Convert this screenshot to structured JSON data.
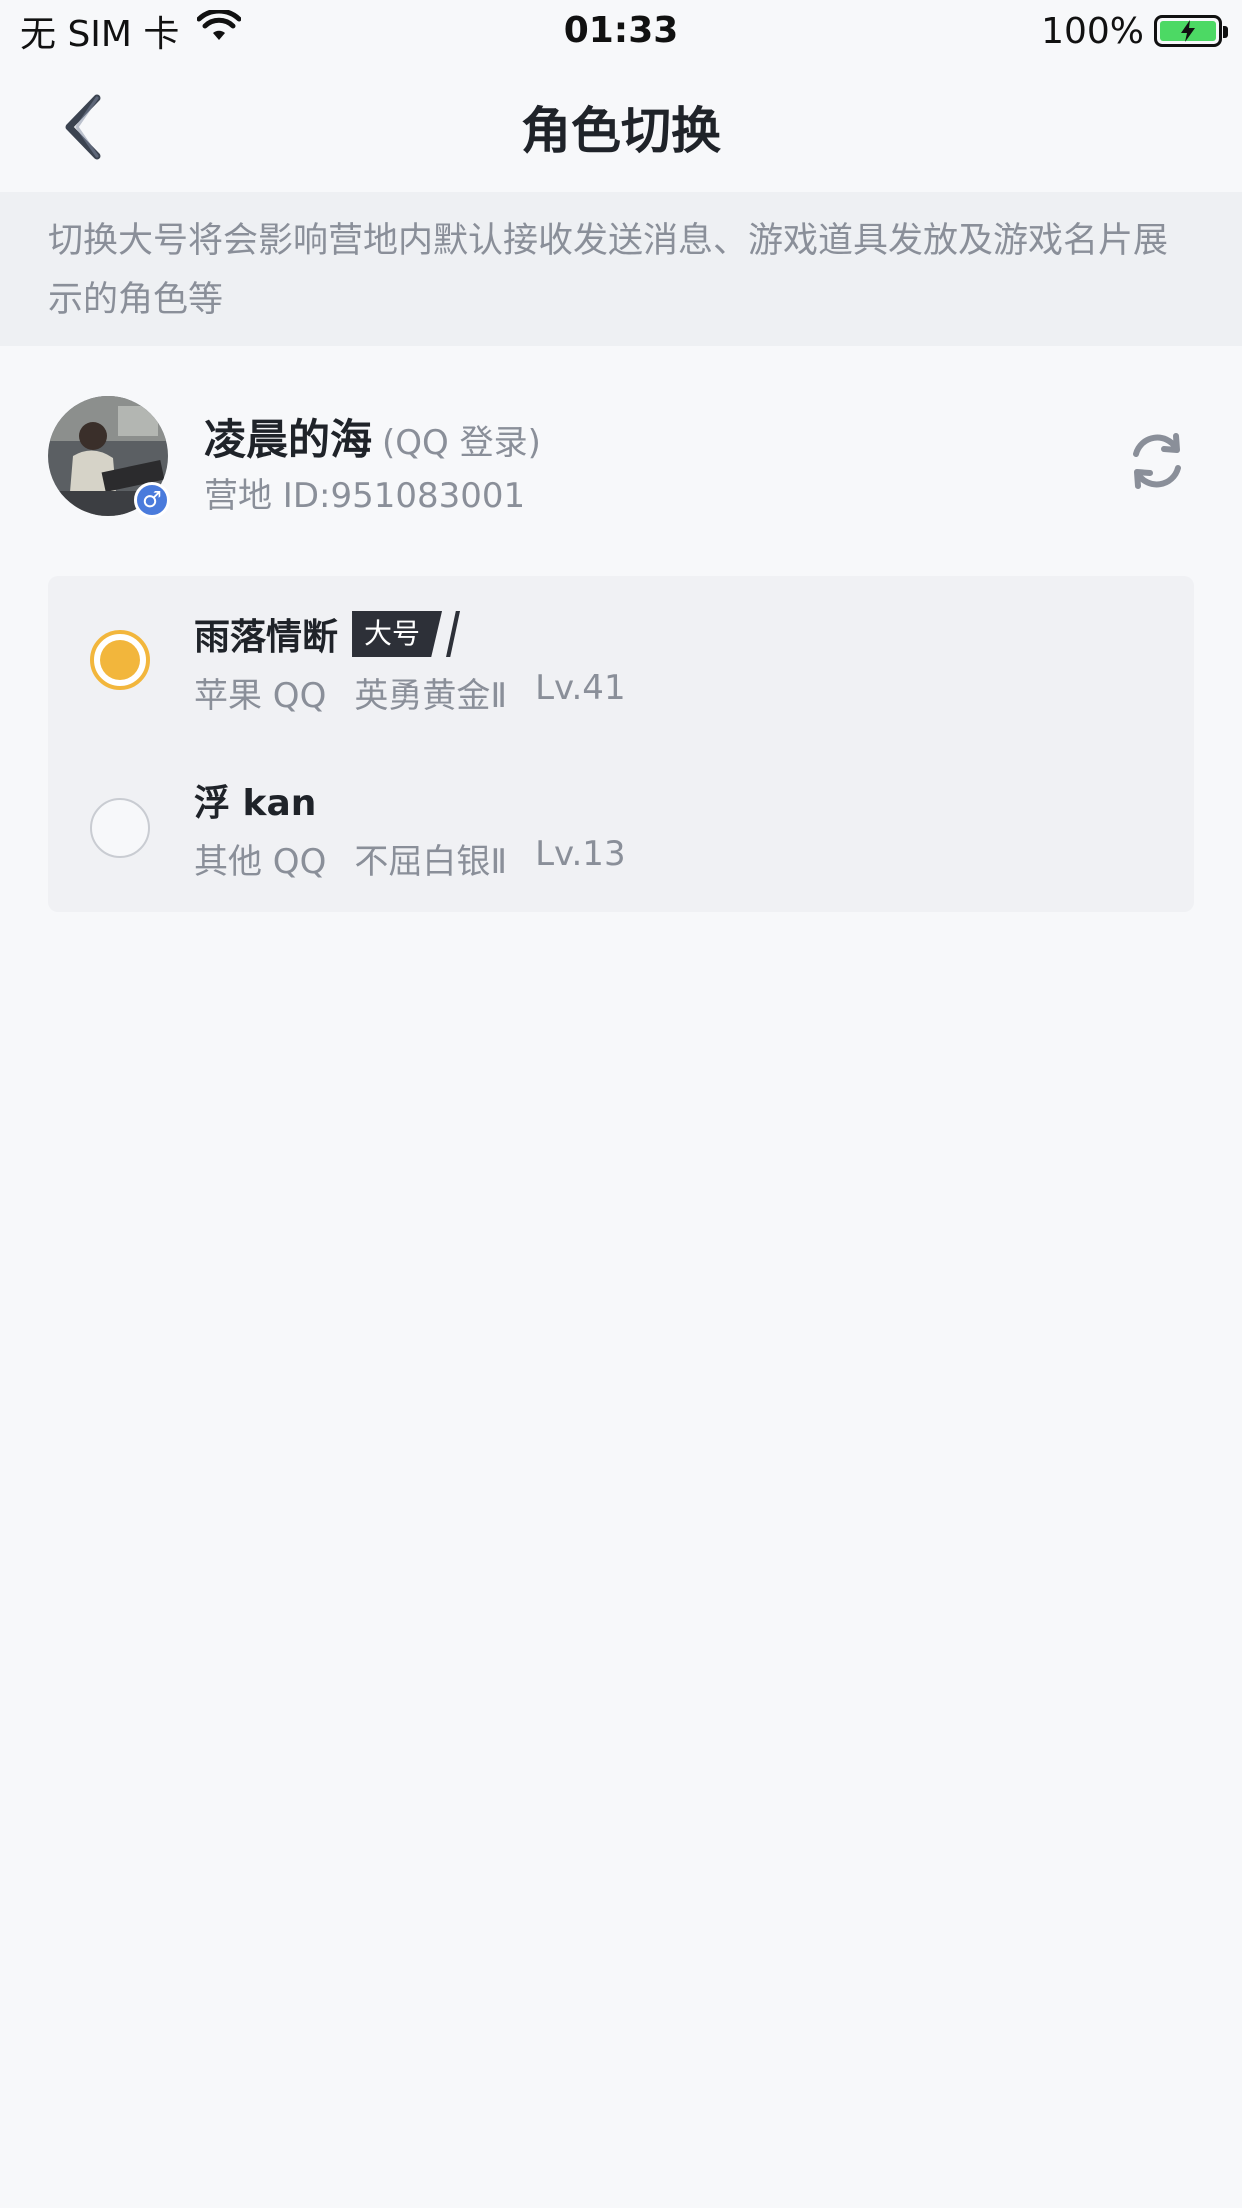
{
  "status_bar": {
    "carrier": "无 SIM 卡",
    "time": "01:33",
    "battery": "100%"
  },
  "nav": {
    "title": "角色切换",
    "back_icon": "chevron-left-icon"
  },
  "notice": {
    "text": "切换大号将会影响营地内默认接收发送消息、游戏道具发放及游戏名片展示的角色等"
  },
  "profile": {
    "name": "凌晨的海",
    "login_type": "(QQ 登录)",
    "id_label": "营地 ID:951083001",
    "gender_icon": "male-icon",
    "refresh_icon": "refresh-icon"
  },
  "roles": [
    {
      "name": "雨落情断",
      "badge": "大号",
      "platform": "苹果 QQ",
      "rank": "英勇黄金Ⅱ",
      "level": "Lv.41",
      "selected": true
    },
    {
      "name": "浮 kan",
      "badge": "",
      "platform": "其他 QQ",
      "rank": "不屈白银Ⅱ",
      "level": "Lv.13",
      "selected": false
    }
  ],
  "colors": {
    "accent": "#f2b63c",
    "background": "#f7f8fa",
    "notice_bg": "#eef0f3",
    "muted_text": "#8a8f99"
  }
}
